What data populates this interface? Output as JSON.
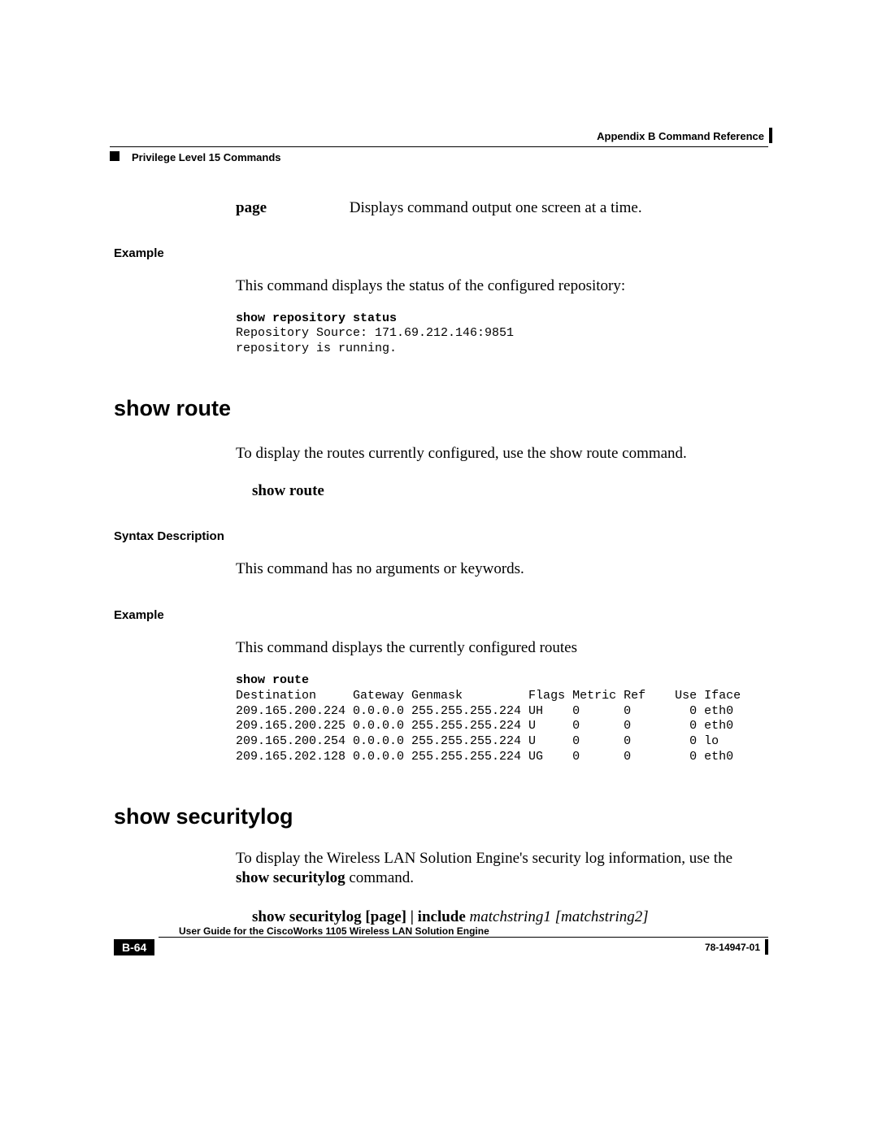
{
  "header": {
    "appendix": "Appendix B     Command Reference",
    "section": "Privilege Level 15 Commands"
  },
  "param": {
    "term": "page",
    "desc": "Displays command output one screen at a time."
  },
  "example1": {
    "label": "Example",
    "intro": "This command displays the status of the configured repository:",
    "code_cmd": "show repository status",
    "code_body": "Repository Source: 171.69.212.146:9851\nrepository is running."
  },
  "route": {
    "heading": "show route",
    "intro": "To display the routes currently configured, use the show route command.",
    "syntax_cmd": "show route",
    "syntax_label": "Syntax Description",
    "syntax_desc": "This command has no arguments or keywords.",
    "example_label": "Example",
    "example_intro": "This command displays the currently configured routes",
    "code_cmd": "show route",
    "code_body": "Destination     Gateway Genmask         Flags Metric Ref    Use Iface\n209.165.200.224 0.0.0.0 255.255.255.224 UH    0      0        0 eth0\n209.165.200.225 0.0.0.0 255.255.255.224 U     0      0        0 eth0\n209.165.200.254 0.0.0.0 255.255.255.224 U     0      0        0 lo\n209.165.202.128 0.0.0.0 255.255.255.224 UG    0      0        0 eth0"
  },
  "seclog": {
    "heading": "show securitylog",
    "intro_a": "To display the Wireless LAN Solution Engine's security log information, use the ",
    "intro_b": "show securitylog",
    "intro_c": " command.",
    "syntax_b1": "show securitylog [page] | include ",
    "syntax_i": "matchstring1 [matchstring2]"
  },
  "footer": {
    "guide": "User Guide for the CiscoWorks 1105 Wireless LAN Solution Engine",
    "page": "B-64",
    "doc": "78-14947-01"
  }
}
